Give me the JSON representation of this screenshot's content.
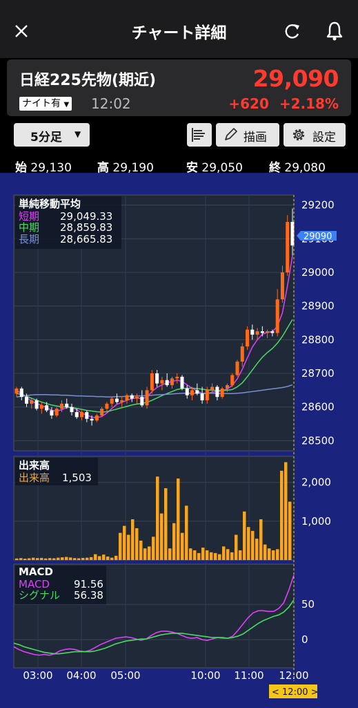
{
  "header": {
    "title": "チャート詳細"
  },
  "quote": {
    "name": "日経225先物(期近)",
    "price": "29,090",
    "session_badge": "ナイト有",
    "time": "12:02",
    "change": "+620",
    "change_pct": "+2.18%",
    "up_color": "#ff3b30"
  },
  "controls": {
    "interval": "5分足",
    "draw_label": "描画",
    "settings_label": "設定"
  },
  "ohlc": [
    {
      "label": "始",
      "value": "29,130"
    },
    {
      "label": "高",
      "value": "29,190"
    },
    {
      "label": "安",
      "value": "29,050"
    },
    {
      "label": "終",
      "value": "29,080"
    }
  ],
  "chart_data": [
    {
      "type": "candlestick",
      "title": "単純移動平均",
      "legend": [
        {
          "name": "短期",
          "value": "29,049.33",
          "color": "#e040fb"
        },
        {
          "name": "中期",
          "value": "28,859.83",
          "color": "#4cd964"
        },
        {
          "name": "長期",
          "value": "28,665.83",
          "color": "#7b8fd6"
        }
      ],
      "yticks": [
        "29200",
        "29100",
        "29000",
        "28900",
        "28800",
        "28700",
        "28600",
        "28500"
      ],
      "ylim": [
        28470,
        29230
      ],
      "current_price_label": "29090",
      "candles": [
        [
          28640,
          28660,
          28630,
          28655
        ],
        [
          28655,
          28660,
          28620,
          28630
        ],
        [
          28630,
          28640,
          28600,
          28610
        ],
        [
          28610,
          28625,
          28595,
          28620
        ],
        [
          28620,
          28625,
          28590,
          28595
        ],
        [
          28595,
          28615,
          28580,
          28605
        ],
        [
          28605,
          28615,
          28585,
          28590
        ],
        [
          28590,
          28600,
          28565,
          28575
        ],
        [
          28575,
          28600,
          28570,
          28595
        ],
        [
          28595,
          28620,
          28585,
          28610
        ],
        [
          28610,
          28625,
          28595,
          28600
        ],
        [
          28600,
          28610,
          28575,
          28585
        ],
        [
          28585,
          28595,
          28565,
          28570
        ],
        [
          28570,
          28590,
          28560,
          28585
        ],
        [
          28585,
          28590,
          28555,
          28565
        ],
        [
          28565,
          28575,
          28545,
          28560
        ],
        [
          28560,
          28580,
          28555,
          28575
        ],
        [
          28575,
          28600,
          28570,
          28595
        ],
        [
          28595,
          28615,
          28585,
          28610
        ],
        [
          28610,
          28630,
          28600,
          28625
        ],
        [
          28625,
          28640,
          28610,
          28615
        ],
        [
          28615,
          28630,
          28600,
          28620
        ],
        [
          28620,
          28640,
          28610,
          28635
        ],
        [
          28635,
          28640,
          28615,
          28625
        ],
        [
          28625,
          28640,
          28610,
          28630
        ],
        [
          28630,
          28650,
          28600,
          28605
        ],
        [
          28605,
          28660,
          28595,
          28650
        ],
        [
          28650,
          28710,
          28640,
          28700
        ],
        [
          28700,
          28710,
          28660,
          28670
        ],
        [
          28670,
          28690,
          28650,
          28680
        ],
        [
          28680,
          28700,
          28660,
          28665
        ],
        [
          28665,
          28690,
          28655,
          28685
        ],
        [
          28685,
          28700,
          28670,
          28690
        ],
        [
          28690,
          28695,
          28650,
          28655
        ],
        [
          28655,
          28665,
          28625,
          28635
        ],
        [
          28635,
          28660,
          28620,
          28650
        ],
        [
          28650,
          28670,
          28635,
          28640
        ],
        [
          28640,
          28660,
          28610,
          28620
        ],
        [
          28620,
          28660,
          28610,
          28650
        ],
        [
          28650,
          28670,
          28640,
          28660
        ],
        [
          28660,
          28665,
          28620,
          28630
        ],
        [
          28630,
          28660,
          28625,
          28655
        ],
        [
          28655,
          28670,
          28645,
          28665
        ],
        [
          28665,
          28700,
          28660,
          28695
        ],
        [
          28695,
          28740,
          28690,
          28735
        ],
        [
          28735,
          28790,
          28720,
          28780
        ],
        [
          28780,
          28840,
          28770,
          28830
        ],
        [
          28830,
          28845,
          28800,
          28815
        ],
        [
          28815,
          28835,
          28800,
          28825
        ],
        [
          28825,
          28840,
          28810,
          28820
        ],
        [
          28820,
          28830,
          28805,
          28825
        ],
        [
          28825,
          28830,
          28810,
          28820
        ],
        [
          28820,
          28950,
          28810,
          28920
        ],
        [
          28920,
          29020,
          28910,
          29000
        ],
        [
          29000,
          29170,
          28990,
          29150
        ],
        [
          29150,
          29190,
          29050,
          29080
        ]
      ],
      "sma": {
        "short": [
          28650,
          28640,
          28628,
          28618,
          28610,
          28605,
          28598,
          28590,
          28588,
          28592,
          28598,
          28600,
          28592,
          28582,
          28576,
          28570,
          28568,
          28572,
          28582,
          28596,
          28608,
          28614,
          28620,
          28625,
          28628,
          28624,
          28630,
          28646,
          28658,
          28666,
          28672,
          28676,
          28680,
          28676,
          28666,
          28656,
          28648,
          28640,
          28640,
          28644,
          28646,
          28648,
          28654,
          28664,
          28684,
          28712,
          28746,
          28778,
          28800,
          28816,
          28822,
          28824,
          28840,
          28880,
          28960,
          29049
        ],
        "mid": [
          28640,
          28638,
          28632,
          28626,
          28620,
          28615,
          28610,
          28606,
          28603,
          28601,
          28600,
          28599,
          28596,
          28593,
          28590,
          28588,
          28586,
          28585,
          28586,
          28590,
          28594,
          28598,
          28602,
          28606,
          28609,
          28611,
          28614,
          28620,
          28627,
          28634,
          28640,
          28646,
          28652,
          28655,
          28656,
          28656,
          28655,
          28653,
          28651,
          28650,
          28649,
          28649,
          28650,
          28652,
          28660,
          28672,
          28690,
          28710,
          28730,
          28748,
          28762,
          28774,
          28790,
          28810,
          28835,
          28860
        ],
        "long": [
          28630,
          28632,
          28634,
          28636,
          28637,
          28637,
          28637,
          28636,
          28636,
          28635,
          28635,
          28634,
          28633,
          28633,
          28632,
          28632,
          28631,
          28631,
          28630,
          28630,
          28631,
          28631,
          28632,
          28632,
          28633,
          28633,
          28634,
          28635,
          28636,
          28637,
          28638,
          28639,
          28640,
          28641,
          28641,
          28641,
          28641,
          28641,
          28641,
          28641,
          28640,
          28640,
          28640,
          28640,
          28641,
          28642,
          28644,
          28646,
          28648,
          28650,
          28652,
          28654,
          28656,
          28658,
          28661,
          28666
        ]
      }
    },
    {
      "type": "bar",
      "title": "出来高",
      "legend": [
        {
          "name": "出来高",
          "value": "1,503",
          "color": "#f5a623"
        }
      ],
      "yticks": [
        "2,000",
        "1,000"
      ],
      "ylim": [
        0,
        2600
      ],
      "values": [
        40,
        50,
        35,
        45,
        60,
        50,
        55,
        40,
        50,
        45,
        60,
        70,
        80,
        65,
        50,
        45,
        55,
        60,
        75,
        150,
        100,
        140,
        90,
        60,
        110,
        700,
        880,
        650,
        1050,
        820,
        500,
        300,
        350,
        600,
        2150,
        1200,
        1850,
        300,
        950,
        2100,
        700,
        1400,
        300,
        250,
        180,
        320,
        250,
        200,
        180,
        150,
        350,
        280,
        200,
        650,
        250,
        1250,
        850,
        750,
        550,
        1050,
        400,
        300,
        250,
        280,
        2300,
        2520,
        1503
      ]
    },
    {
      "type": "line",
      "title": "MACD",
      "legend": [
        {
          "name": "MACD",
          "value": "91.56",
          "color": "#e040fb"
        },
        {
          "name": "シグナル",
          "value": "56.38",
          "color": "#4cd964"
        }
      ],
      "yticks": [
        "50",
        "0"
      ],
      "ylim": [
        -40,
        105
      ],
      "series": [
        {
          "name": "MACD",
          "values": [
            -10,
            -14,
            -17,
            -19,
            -21,
            -22,
            -21,
            -22,
            -20,
            -16,
            -14,
            -13,
            -14,
            -16,
            -17,
            -15,
            -11,
            -7,
            -4,
            -1,
            2,
            3,
            4,
            3,
            1,
            -1,
            1,
            6,
            10,
            12,
            12,
            11,
            9,
            6,
            3,
            2,
            3,
            0,
            -1,
            1,
            3,
            2,
            2,
            5,
            13,
            22,
            31,
            38,
            41,
            41,
            40,
            40,
            44,
            52,
            70,
            91.56
          ]
        },
        {
          "name": "シグナル",
          "values": [
            -5,
            -7,
            -10,
            -12,
            -14,
            -16,
            -18,
            -19,
            -20,
            -20,
            -19,
            -18,
            -17,
            -17,
            -17,
            -17,
            -16,
            -14,
            -12,
            -9,
            -6,
            -4,
            -2,
            -1,
            0,
            1,
            1,
            3,
            5,
            7,
            8,
            9,
            9,
            9,
            8,
            7,
            6,
            5,
            4,
            3,
            3,
            3,
            2,
            3,
            5,
            8,
            13,
            18,
            23,
            27,
            30,
            33,
            35,
            39,
            46,
            56.38
          ]
        }
      ]
    }
  ],
  "time_axis": {
    "labels": [
      "03:00",
      "04:00",
      "05:00",
      "10:00",
      "11:00",
      "12:00"
    ],
    "cursor_label": "< 12:00 >"
  }
}
